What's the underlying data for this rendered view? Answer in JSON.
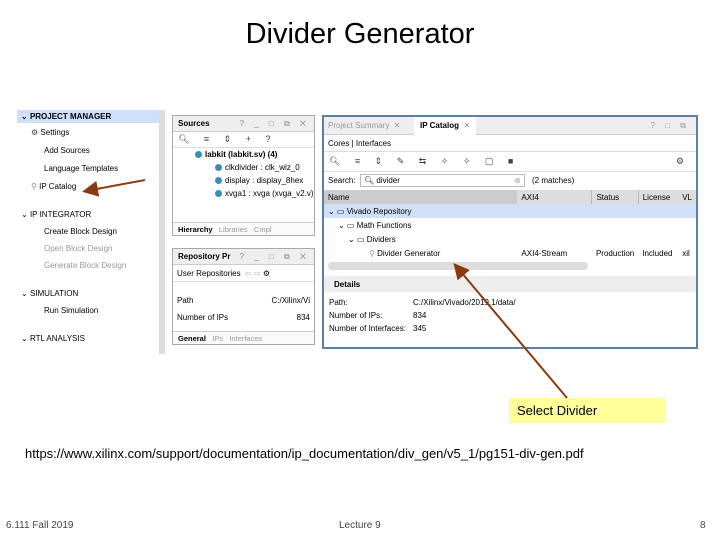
{
  "slide": {
    "title": "Divider Generator",
    "note": "Select Divider",
    "url": "https://www.xilinx.com/support/documentation/ip_documentation/div_gen/v5_1/pg151-div-gen.pdf",
    "footer_left": "6.111 Fall 2019",
    "footer_center": "Lecture 9",
    "page_number": "8",
    "arrow_color": "#8b3a10",
    "note_color": "#ffff99"
  },
  "flow": {
    "sections": [
      {
        "label": "PROJECT MANAGER",
        "items": [
          "Settings",
          "Add Sources",
          "Language Templates",
          "IP Catalog"
        ]
      },
      {
        "label": "IP INTEGRATOR",
        "items": [
          "Create Block Design",
          "Open Block Design",
          "Generate Block Design"
        ]
      },
      {
        "label": "SIMULATION",
        "items": [
          "Run Simulation"
        ]
      },
      {
        "label": "RTL ANALYSIS",
        "items": []
      }
    ]
  },
  "sources": {
    "title": "Sources",
    "controls": "? _ □ ⧉ ✕",
    "top": "labkit (labkit.sv) (4)",
    "rows": [
      "clkdivider : clk_wiz_0",
      "display : display_8hex",
      "xvga1 : xvga (xvga_v2.v)"
    ],
    "tabs": [
      "Hierarchy",
      "Libraries",
      "Cmpl"
    ]
  },
  "repo": {
    "title": "Repository Pr",
    "controls": "? _ □ ⧉ ✕",
    "toolbar": "User Repositories",
    "rows": [
      {
        "k": "Path",
        "v": "C:/Xilinx/Vi"
      },
      {
        "k": "Number of IPs",
        "v": "834"
      }
    ],
    "tabs": [
      "General",
      "IPs",
      "Interfaces"
    ]
  },
  "catalog": {
    "tabs": [
      "Project Summary",
      "IP Catalog"
    ],
    "controls": "? □ ⧉",
    "subtabs": "Cores | Interfaces",
    "search_label": "Search:",
    "search_value": "divider",
    "matches": "(2 matches)",
    "columns": [
      "Name",
      "AXI4",
      "Status",
      "License",
      "VL"
    ],
    "tree": [
      {
        "label": "Vivado Repository",
        "level": 0
      },
      {
        "label": "Math Functions",
        "level": 1
      },
      {
        "label": "Dividers",
        "level": 2
      }
    ],
    "item": {
      "name": "Divider Generator",
      "axi": "AXI4-Stream",
      "status": "Production",
      "license": "Included",
      "vlnv": "xil"
    },
    "details_title": "Details",
    "details": [
      {
        "k": "Path:",
        "v": "C:/Xilinx/Vivado/2019.1/data/"
      },
      {
        "k": "Number of IPs:",
        "v": "834"
      },
      {
        "k": "Number of Interfaces:",
        "v": "345"
      }
    ]
  }
}
